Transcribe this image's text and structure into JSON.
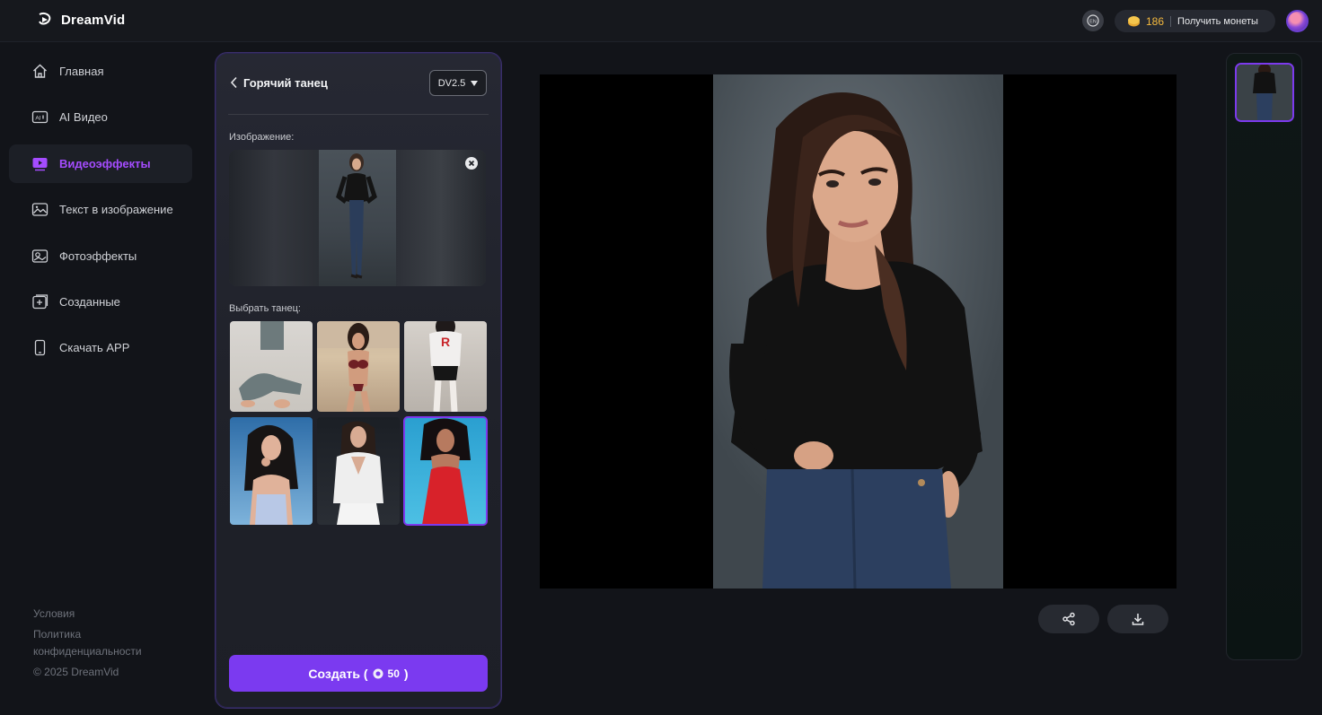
{
  "app": {
    "name": "DreamVid",
    "coins": "186",
    "get_coins_label": "Получить монеты",
    "lang_label": "EN",
    "accent_color": "#7b3af0"
  },
  "sidebar": {
    "items": [
      {
        "label": "Главная",
        "icon": "home-icon"
      },
      {
        "label": "AI Видео",
        "icon": "ai-video-icon"
      },
      {
        "label": "Видеоэффекты",
        "icon": "video-effects-icon",
        "active": true
      },
      {
        "label": "Текст в изображение",
        "icon": "text-to-image-icon"
      },
      {
        "label": "Фотоэффекты",
        "icon": "photo-effects-icon"
      },
      {
        "label": "Созданные",
        "icon": "created-icon"
      },
      {
        "label": "Скачать APP",
        "icon": "phone-icon"
      }
    ],
    "footer": {
      "terms": "Условия",
      "privacy": "Политика конфиденциальности",
      "copyright": "© 2025 DreamVid"
    }
  },
  "panel": {
    "title": "Горячий танец",
    "version": "DV2.5",
    "image_label": "Изображение:",
    "dance_label": "Выбрать танец:",
    "create_label": "Создать (",
    "create_cost": "50",
    "create_close": ")"
  }
}
